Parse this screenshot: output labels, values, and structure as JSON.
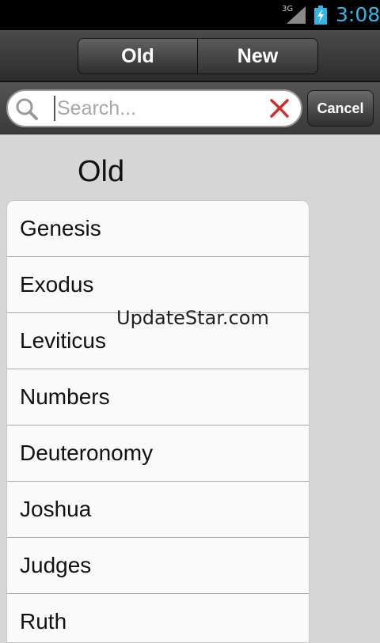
{
  "status_bar": {
    "network": "3G",
    "time": "3:08"
  },
  "header": {
    "segments": [
      {
        "label": "Old",
        "selected": true
      },
      {
        "label": "New",
        "selected": false
      }
    ]
  },
  "search": {
    "value": "",
    "placeholder": "Search...",
    "cancel_label": "Cancel"
  },
  "section": {
    "title": "Old"
  },
  "books": [
    "Genesis",
    "Exodus",
    "Leviticus",
    "Numbers",
    "Deuteronomy",
    "Joshua",
    "Judges",
    "Ruth"
  ],
  "watermark": "UpdateStar.com",
  "colors": {
    "accent": "#33b5e5",
    "clear_icon": "#d42a2a"
  }
}
